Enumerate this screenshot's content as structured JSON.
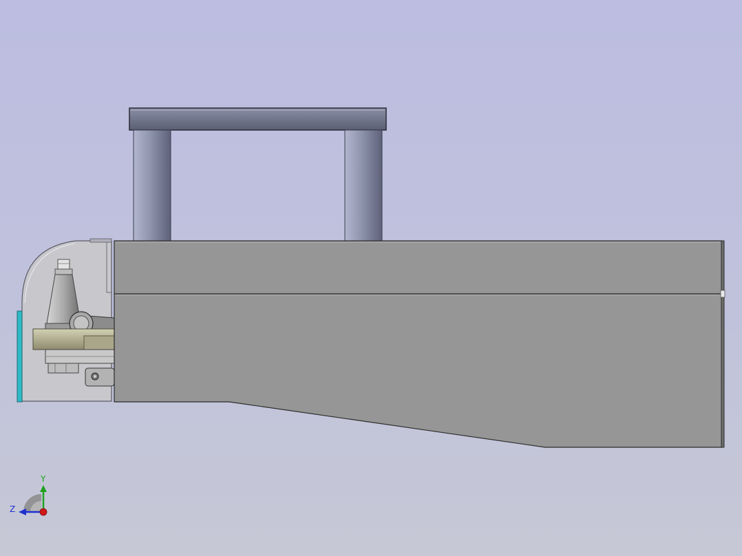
{
  "view": {
    "background_top": "#bcbde1",
    "background_bottom": "#c6c8d6"
  },
  "model": {
    "body_color": "#969696",
    "beam_color": "#6d7187",
    "pillar_color": "#8f94ad",
    "enclosure_color": "#c8c8cc",
    "spindle_color": "#a9a9a9",
    "base_plate_color": "#b8b596",
    "window_color": "#34c5d0"
  },
  "triad": {
    "y_label": "Y",
    "z_label": "Z",
    "y_color": "#1fa11f",
    "z_color": "#1f2fd0",
    "x_color": "#d01818"
  }
}
